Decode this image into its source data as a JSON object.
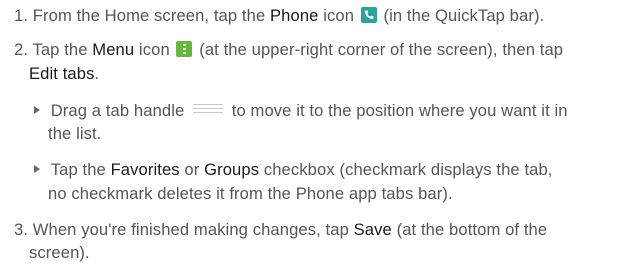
{
  "step1": {
    "prefix": "1. From the Home screen, tap the ",
    "bold": "Phone",
    "middle": " icon ",
    "suffix": " (in the QuickTap bar)."
  },
  "step2": {
    "prefix": "2. Tap the ",
    "bold": "Menu",
    "middle": " icon ",
    "suffix": " (at the upper-right corner of the screen), then tap",
    "line2_bold": "Edit tabs",
    "line2_suffix": "."
  },
  "bullet1": {
    "prefix": "Drag a tab handle ",
    "suffix": " to move it to the position where you want it in",
    "line2": "the list."
  },
  "bullet2": {
    "prefix": "Tap the ",
    "bold1": "Favorites",
    "or": " or ",
    "bold2": "Groups",
    "suffix": " checkbox (checkmark displays the tab,",
    "line2": "no checkmark deletes it from the Phone app tabs bar)."
  },
  "step3": {
    "prefix": "3. When you're finished making changes, tap ",
    "bold": "Save",
    "suffix": " (at the bottom of the",
    "line2": "screen)."
  },
  "icons": {
    "phone_color": "#2aa39b",
    "menu_color": "#67b83a"
  }
}
